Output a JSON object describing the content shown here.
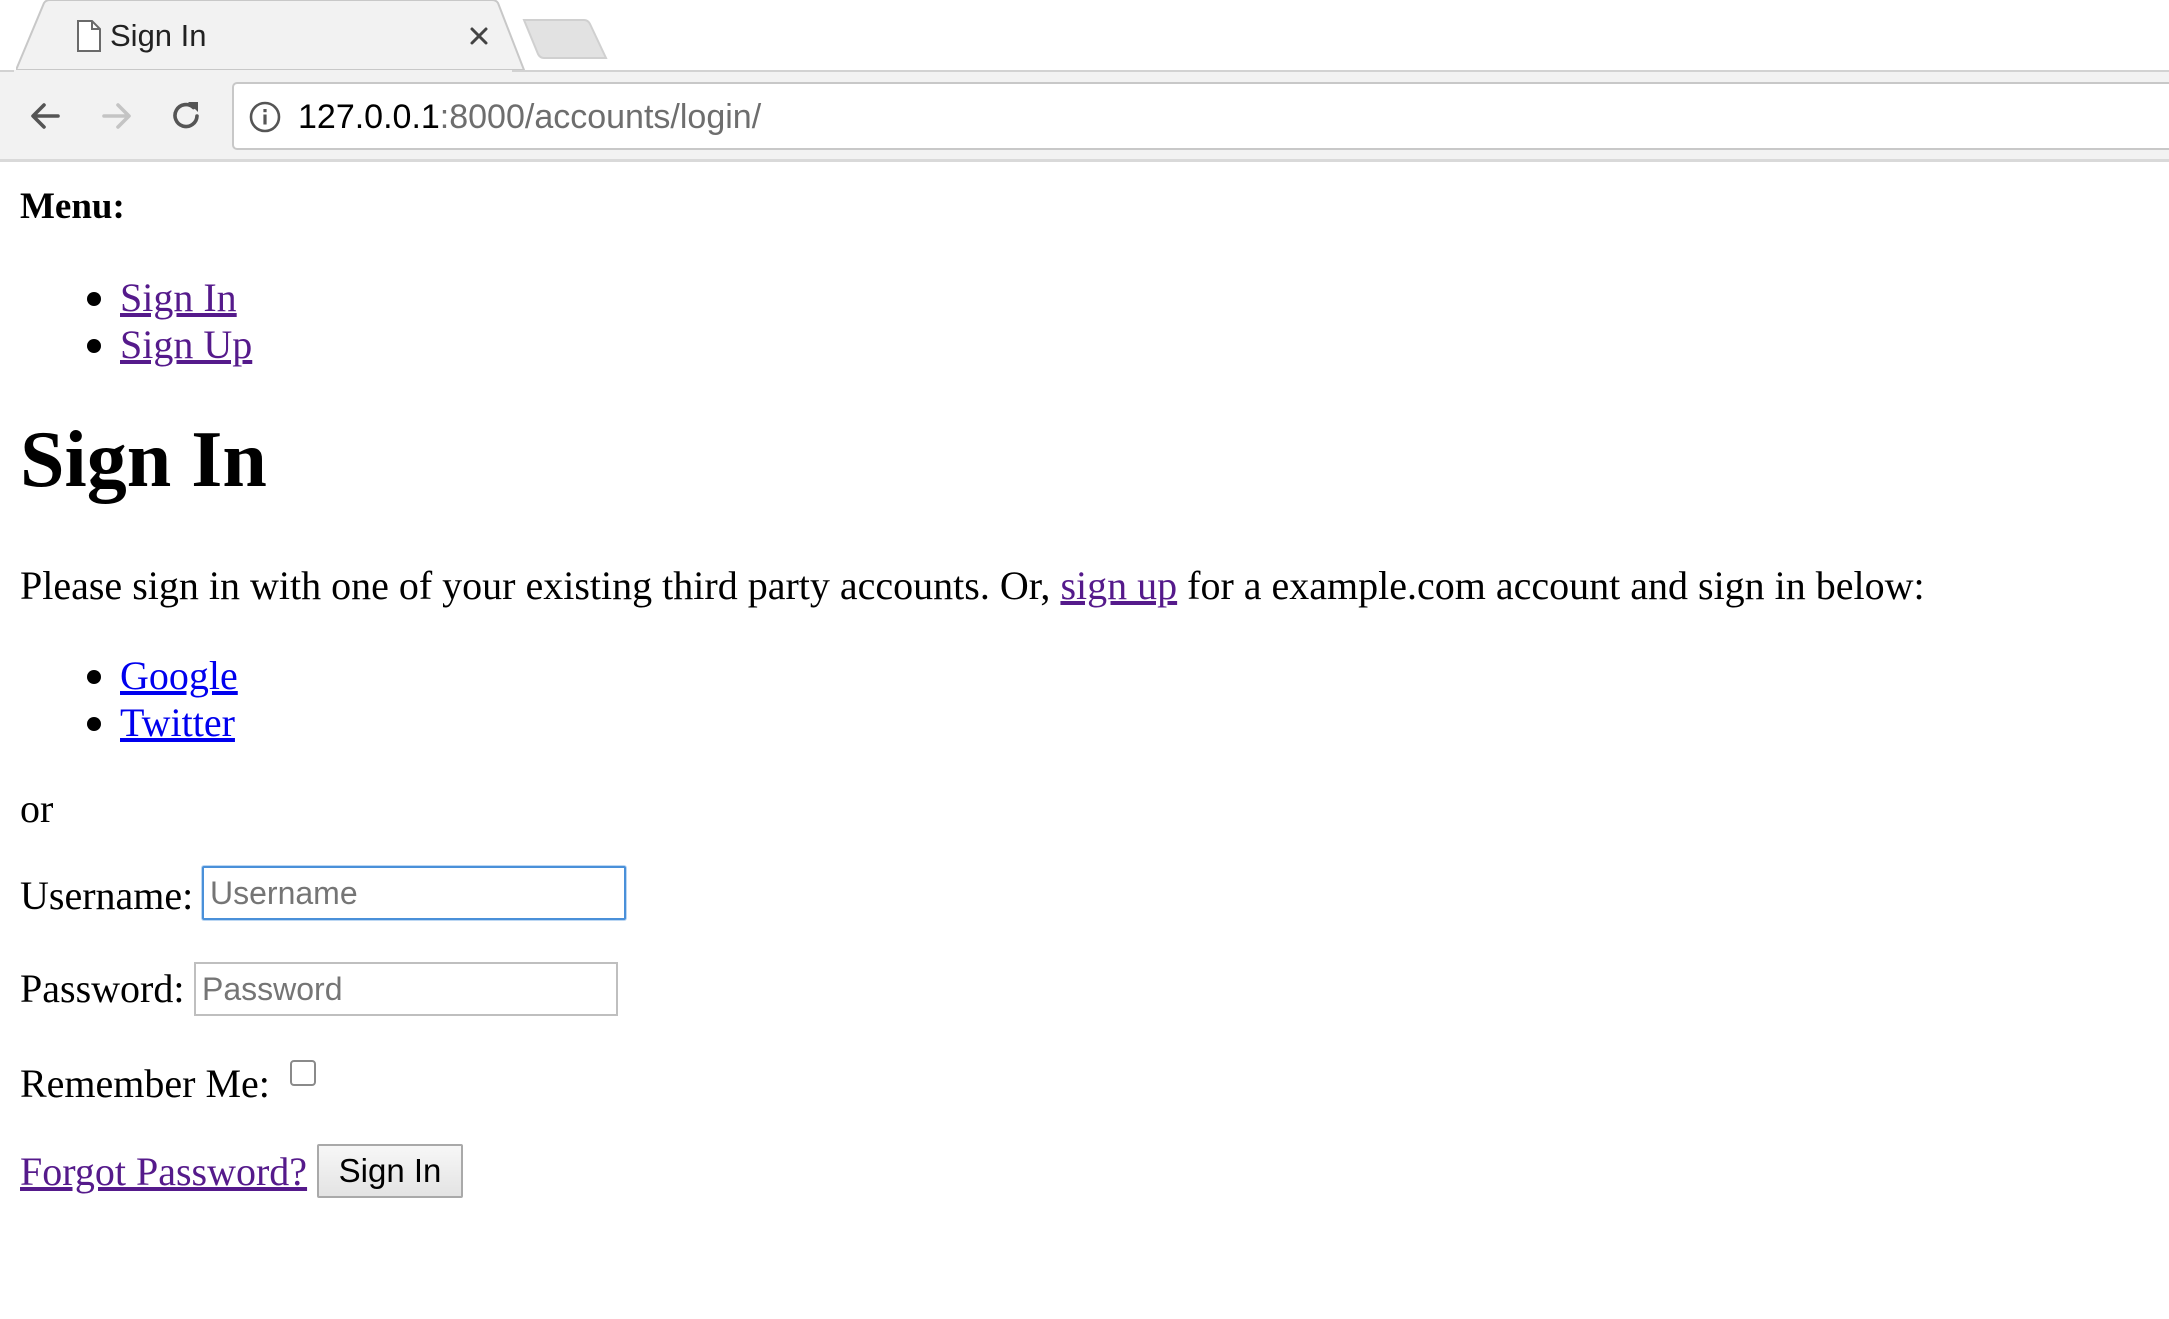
{
  "browser": {
    "tab_title": "Sign In",
    "url_host": "127.0.0.1",
    "url_rest": ":8000/accounts/login/"
  },
  "page": {
    "menu_heading": "Menu:",
    "menu_items": [
      {
        "label": "Sign In"
      },
      {
        "label": "Sign Up"
      }
    ],
    "title": "Sign In",
    "intro_before": "Please sign in with one of your existing third party accounts. Or, ",
    "intro_link": "sign up",
    "intro_after": " for a example.com account and sign in below:",
    "providers": [
      {
        "label": "Google"
      },
      {
        "label": "Twitter"
      }
    ],
    "or_text": "or",
    "form": {
      "username_label": "Username:",
      "username_placeholder": "Username",
      "username_value": "",
      "password_label": "Password:",
      "password_placeholder": "Password",
      "password_value": "",
      "remember_label": "Remember Me:",
      "remember_checked": false,
      "forgot_link": "Forgot Password?",
      "submit_label": "Sign In"
    }
  },
  "colors": {
    "visited_link": "#551a8b",
    "unvisited_link": "#0000ee",
    "focus_ring": "#4a90d9"
  }
}
